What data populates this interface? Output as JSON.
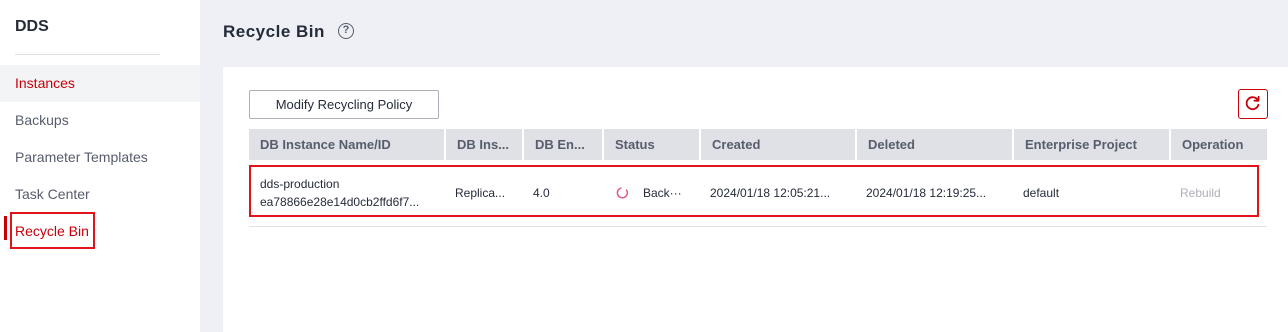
{
  "sidebar": {
    "title": "DDS",
    "items": [
      {
        "label": "Instances"
      },
      {
        "label": "Backups"
      },
      {
        "label": "Parameter Templates"
      },
      {
        "label": "Task Center"
      },
      {
        "label": "Recycle Bin"
      }
    ]
  },
  "header": {
    "title": "Recycle Bin",
    "help_icon": "question-circle-icon",
    "help_glyph": "?"
  },
  "toolbar": {
    "policy_button_label": "Modify Recycling Policy",
    "refresh_icon": "refresh-icon"
  },
  "table": {
    "columns": [
      "DB Instance Name/ID",
      "DB Ins...",
      "DB En...",
      "Status",
      "Created",
      "Deleted",
      "Enterprise Project",
      "Operation"
    ],
    "rows": [
      {
        "name": "dds-production",
        "id": "ea78866e28e14d0cb2ffd6f7...",
        "instance_type": "Replica...",
        "engine": "4.0",
        "status": "Back···",
        "created": "2024/01/18 12:05:21...",
        "deleted": "2024/01/18 12:19:25...",
        "enterprise_project": "default",
        "operation": "Rebuild"
      }
    ]
  },
  "colors": {
    "accent": "#c7000b",
    "highlight": "#e3131c",
    "spinner": "#e0508a"
  }
}
